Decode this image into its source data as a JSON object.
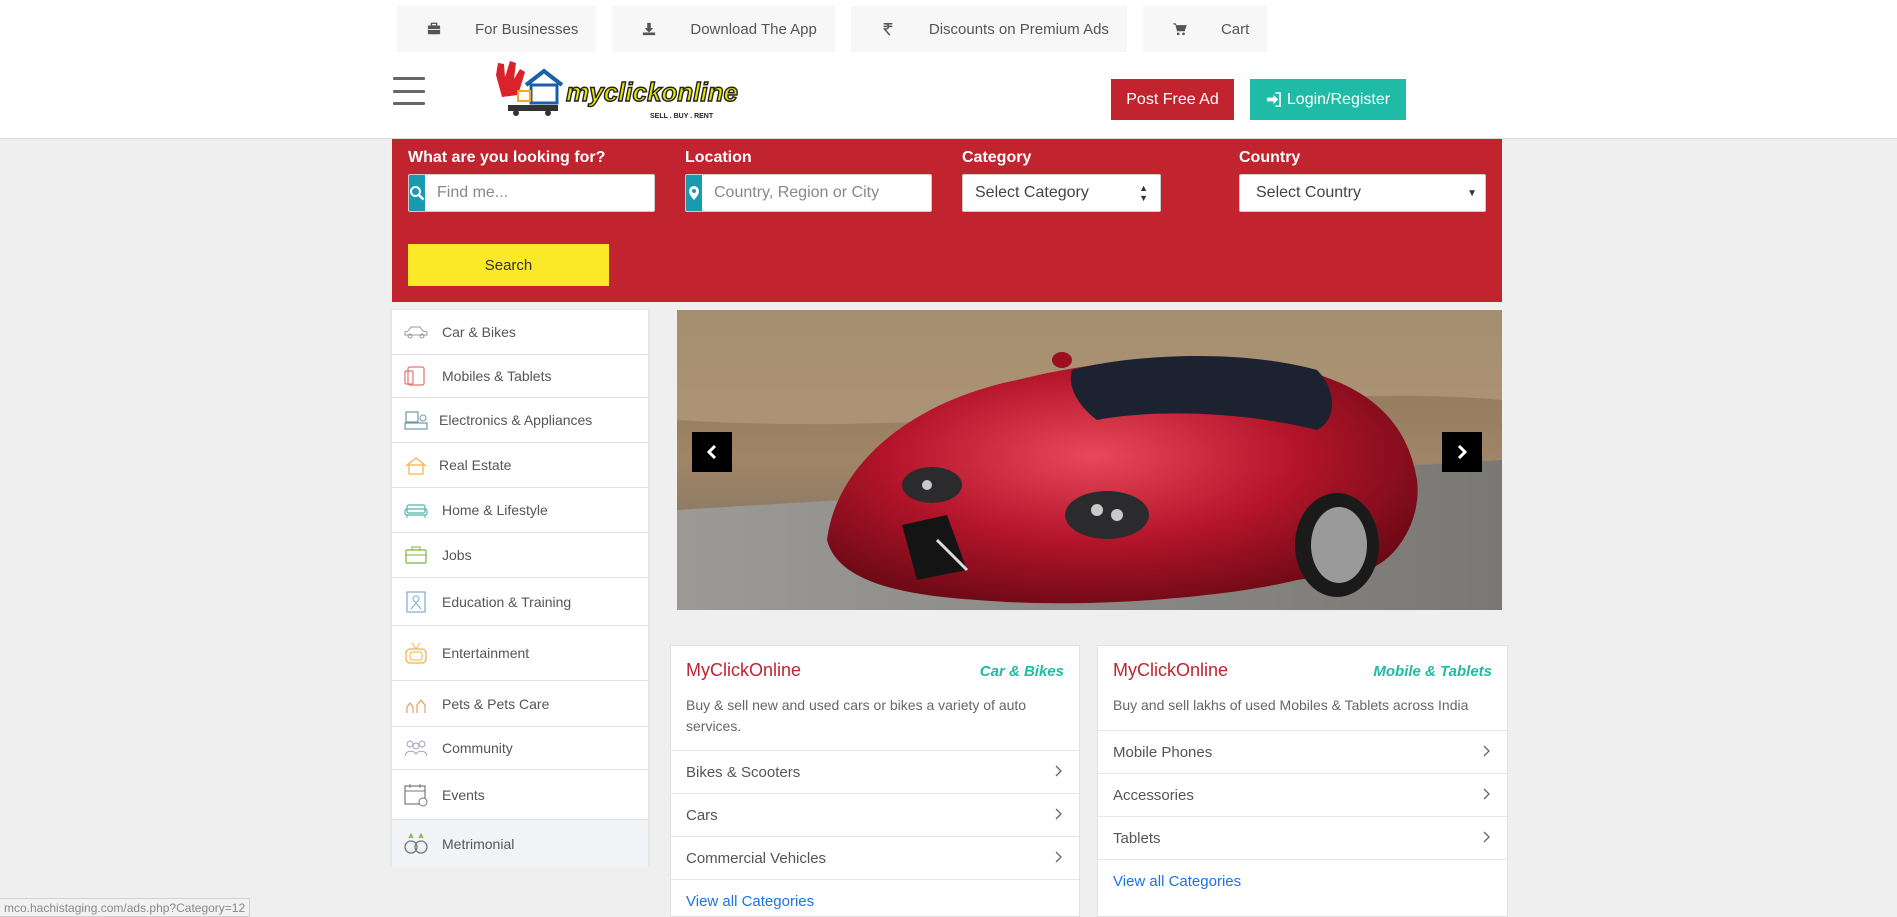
{
  "topbar": {
    "items": [
      {
        "label": "For Businesses",
        "icon": "briefcase-icon"
      },
      {
        "label": "Download The App",
        "icon": "download-icon"
      },
      {
        "label": "Discounts on Premium Ads",
        "icon": "rupee-icon"
      },
      {
        "label": "Cart",
        "icon": "cart-icon"
      }
    ]
  },
  "header": {
    "logo_text": "myclickonline",
    "logo_tagline": "SELL . BUY . RENT",
    "post_ad_label": "Post Free Ad",
    "login_label": "Login/Register",
    "post_ad_color": "#c1232f",
    "login_color": "#1fbba6"
  },
  "search": {
    "what_label": "What are you looking for?",
    "what_placeholder": "Find me...",
    "location_label": "Location",
    "location_placeholder": "Country, Region or City",
    "category_label": "Category",
    "category_value": "Select Category",
    "country_label": "Country",
    "country_value": "Select Country",
    "search_button": "Search",
    "panel_color": "#c1232f",
    "button_color": "#fbe829"
  },
  "sidebar": {
    "items": [
      {
        "label": "Car & Bikes",
        "icon": "car-icon"
      },
      {
        "label": "Mobiles & Tablets",
        "icon": "mobile-icon"
      },
      {
        "label": "Electronics & Appliances",
        "icon": "appliance-icon"
      },
      {
        "label": "Real Estate",
        "icon": "house-icon"
      },
      {
        "label": "Home & Lifestyle",
        "icon": "sofa-icon"
      },
      {
        "label": "Jobs",
        "icon": "briefcase-icon"
      },
      {
        "label": "Education & Training",
        "icon": "education-icon"
      },
      {
        "label": "Entertainment",
        "icon": "tv-icon"
      },
      {
        "label": "Pets & Pets Care",
        "icon": "pets-icon"
      },
      {
        "label": "Community",
        "icon": "community-icon"
      },
      {
        "label": "Events",
        "icon": "calendar-icon"
      },
      {
        "label": "Metrimonial",
        "icon": "rings-icon"
      }
    ]
  },
  "carousel": {
    "prev_icon": "chevron-left-icon",
    "next_icon": "chevron-right-icon"
  },
  "cards": [
    {
      "title": "MyClickOnline",
      "tag": "Car & Bikes",
      "description": "Buy & sell new and used cars or bikes a variety of auto services.",
      "rows": [
        "Bikes & Scooters",
        "Cars",
        "Commercial Vehicles"
      ],
      "link": "View all Categories"
    },
    {
      "title": "MyClickOnline",
      "tag": "Mobile & Tablets",
      "description": "Buy and sell lakhs of used Mobiles & Tablets across India",
      "rows": [
        "Mobile Phones",
        "Accessories",
        "Tablets"
      ],
      "link": "View all Categories"
    }
  ],
  "status_bar": {
    "url": "mco.hachistaging.com/ads.php?Category=12"
  }
}
